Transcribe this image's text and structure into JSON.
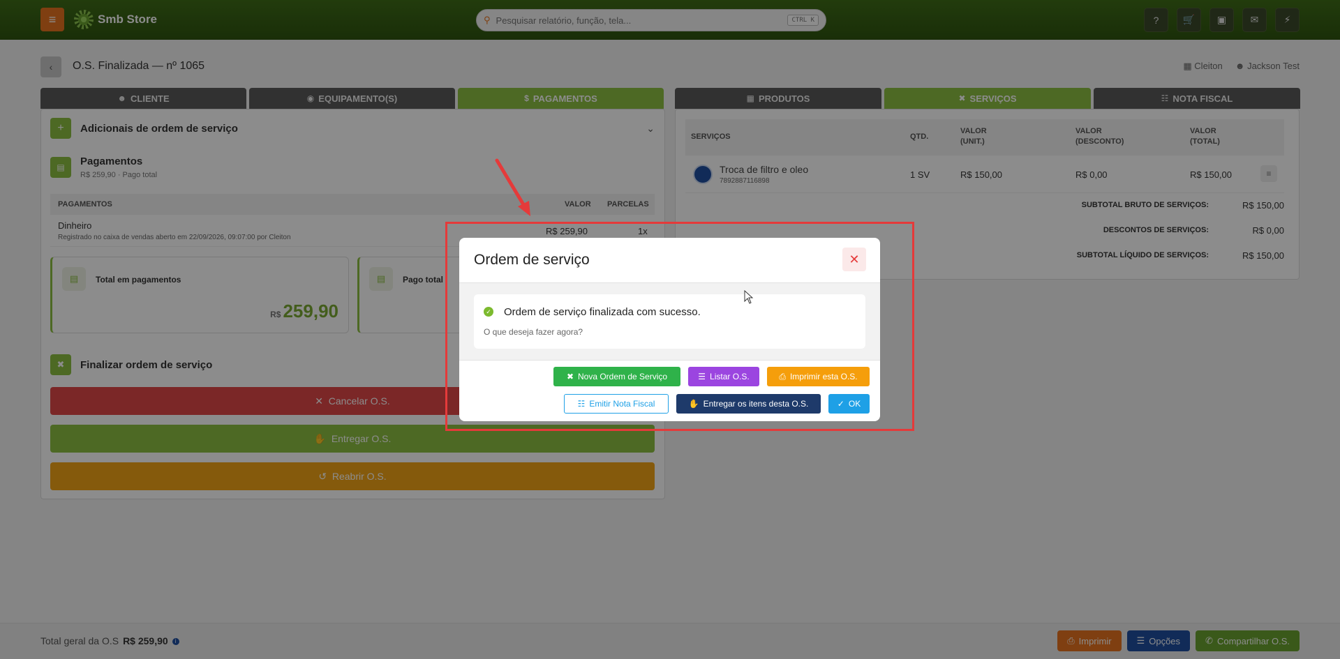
{
  "header": {
    "brand": "Smb Store",
    "search_placeholder": "Pesquisar relatório, função, tela...",
    "search_shortcut": "CTRL K",
    "icons": [
      "help-icon",
      "cart-icon",
      "monitor-icon",
      "chat-icon",
      "bolt-icon"
    ]
  },
  "page": {
    "title": "O.S. Finalizada — nº 1065",
    "store_user": "Cleiton",
    "user": "Jackson Test"
  },
  "left_tabs": [
    "CLIENTE",
    "EQUIPAMENTO(S)",
    "PAGAMENTOS"
  ],
  "right_tabs": [
    "PRODUTOS",
    "SERVIÇOS",
    "NOTA FISCAL"
  ],
  "left": {
    "adicionais_title": "Adicionais de ordem de serviço",
    "pagamentos_title": "Pagamentos",
    "pagamentos_sub": "R$ 259,90 · Pago total",
    "table_headers": {
      "pagamentos": "PAGAMENTOS",
      "valor": "VALOR",
      "parcelas": "PARCELAS"
    },
    "payment_row": {
      "method": "Dinheiro",
      "note": "Registrado no caixa de vendas aberto em 22/09/2026, 09:07:00 por Cleiton",
      "value": "R$ 259,90",
      "installments": "1x"
    },
    "card_total_label": "Total em pagamentos",
    "card_total_currency": "R$",
    "card_total_value": "259,90",
    "card_paid_label": "Pago total",
    "finalizar_title": "Finalizar ordem de serviço",
    "cancel_label": "Cancelar O.S.",
    "deliver_label": "Entregar O.S.",
    "reopen_label": "Reabrir O.S."
  },
  "right": {
    "headers": [
      "SERVIÇOS",
      "QTD.",
      "VALOR\n(UNIT.)",
      "VALOR\n(DESCONTO)",
      "VALOR\n(TOTAL)"
    ],
    "h_servicos": "SERVIÇOS",
    "h_qtd": "QTD.",
    "h_unit_1": "VALOR",
    "h_unit_2": "(UNIT.)",
    "h_desc_1": "VALOR",
    "h_desc_2": "(DESCONTO)",
    "h_total_1": "VALOR",
    "h_total_2": "(TOTAL)",
    "row": {
      "name": "Troca de filtro e oleo",
      "code": "7892887116898",
      "qty": "1 SV",
      "unit": "R$ 150,00",
      "discount": "R$ 0,00",
      "total": "R$ 150,00"
    },
    "subtotal_bruto_label": "SUBTOTAL BRUTO DE SERVIÇOS:",
    "subtotal_bruto_value": "R$ 150,00",
    "descontos_label": "DESCONTOS DE SERVIÇOS:",
    "descontos_value": "R$ 0,00",
    "subtotal_liquido_label": "SUBTOTAL LÍQUIDO DE SERVIÇOS:",
    "subtotal_liquido_value": "R$ 150,00"
  },
  "bottom": {
    "total_label": "Total geral da O.S",
    "total_value": "R$ 259,90",
    "print_label": "Imprimir",
    "options_label": "Opções",
    "share_label": "Compartilhar O.S."
  },
  "modal": {
    "title": "Ordem de serviço",
    "message": "Ordem de serviço finalizada com sucesso.",
    "question": "O que deseja fazer agora?",
    "btn_new": "Nova Ordem de Serviço",
    "btn_list": "Listar O.S.",
    "btn_print": "Imprimir esta O.S.",
    "btn_invoice": "Emitir Nota Fiscal",
    "btn_deliver": "Entregar os itens desta O.S.",
    "btn_ok": "OK"
  },
  "colors": {
    "brand_green": "#8dbf43",
    "header_green": "#3f6d17",
    "orange": "#e8741f",
    "danger": "#e53a3a",
    "success_btn": "#2fb24a",
    "purple_btn": "#9b45e0",
    "amber_btn": "#f59e0b",
    "navy_btn": "#1e3a6a",
    "sky_btn": "#1ea0e6"
  }
}
